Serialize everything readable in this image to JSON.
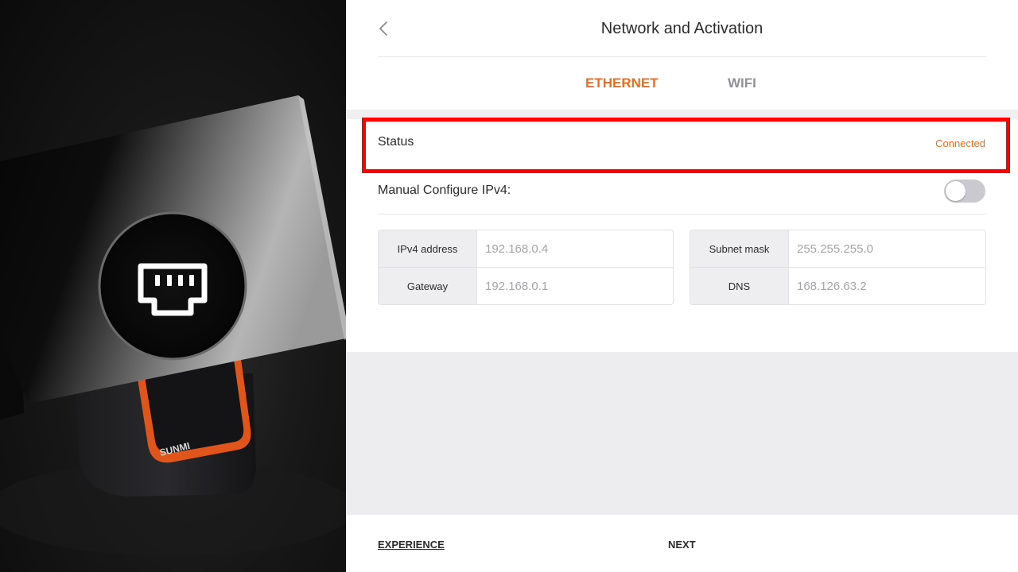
{
  "header": {
    "back_icon": "chevron-left-icon",
    "title": "Network and Activation"
  },
  "tabs": [
    {
      "label": "ETHERNET",
      "active": true
    },
    {
      "label": "WIFI",
      "active": false
    }
  ],
  "status": {
    "label": "Status",
    "value": "Connected"
  },
  "manual_config": {
    "label": "Manual Configure IPv4:",
    "enabled": false
  },
  "ip_config": {
    "left": [
      {
        "key": "IPv4 address",
        "value": "192.168.0.4"
      },
      {
        "key": "Gateway",
        "value": "192.168.0.1"
      }
    ],
    "right": [
      {
        "key": "Subnet mask",
        "value": "255.255.255.0"
      },
      {
        "key": "DNS",
        "value": "168.126.63.2"
      }
    ]
  },
  "footer": {
    "experience_label": "EXPERIENCE",
    "next_label": "NEXT"
  },
  "hero": {
    "icon": "ethernet-port-icon",
    "brand_logo": "SUNMI"
  },
  "colors": {
    "accent": "#f26b1d",
    "highlight_border": "#ff0000",
    "toggle_off": "#c9c9cf"
  }
}
